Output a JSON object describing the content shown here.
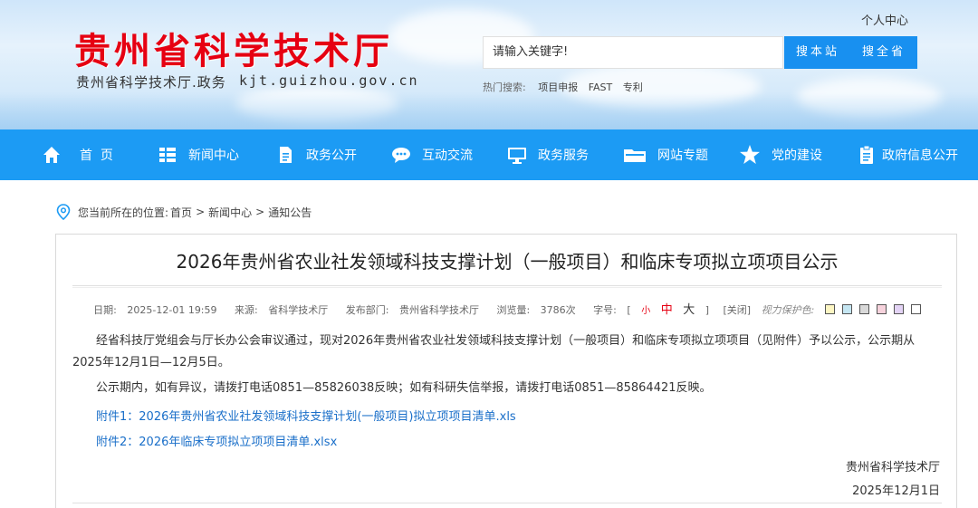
{
  "header": {
    "site_title": "贵州省科学技术厅",
    "site_subtitle": "贵州省科学技术厅.政务",
    "site_domain": "kjt.guizhou.gov.cn",
    "personal_center": "个人中心",
    "search": {
      "placeholder": "请输入关键字!",
      "btn_site": "搜本站",
      "btn_all": "搜全省"
    },
    "hot": {
      "label": "热门搜索:",
      "items": [
        "项目申报",
        "FAST",
        "专利"
      ]
    }
  },
  "nav": {
    "items": [
      {
        "label": "首  页",
        "icon": "home-icon"
      },
      {
        "label": "新闻中心",
        "icon": "grid-list-icon"
      },
      {
        "label": "政务公开",
        "icon": "document-icon"
      },
      {
        "label": "互动交流",
        "icon": "chat-bubble-icon"
      },
      {
        "label": "政务服务",
        "icon": "monitor-icon"
      },
      {
        "label": "网站专题",
        "icon": "folder-icon"
      },
      {
        "label": "党的建设",
        "icon": "star-icon"
      },
      {
        "label": "政府信息公开",
        "icon": "clipboard-icon"
      }
    ]
  },
  "breadcrumb": {
    "prefix": "您当前所在的位置:",
    "home": "首页",
    "sep": ">",
    "section": "新闻中心",
    "current": "通知公告"
  },
  "article": {
    "title": "2026年贵州省农业社发领域科技支撑计划（一般项目）和临床专项拟立项项目公示",
    "meta": {
      "date_label": "日期:",
      "date": "2025-12-01 19:59",
      "source_label": "来源:",
      "source": "省科学技术厅",
      "dept_label": "发布部门:",
      "dept": "贵州省科学技术厅",
      "views_label": "浏览量:",
      "views": "3786次",
      "font_label": "字号:",
      "bracket_open": "[",
      "small": "小",
      "mid": "中",
      "big": "大",
      "bracket_close": "]",
      "close": "[关闭]",
      "protect_label": "视力保护色:",
      "swatches": [
        "#fdf6c3",
        "#c5e6f2",
        "#d9d9d9",
        "#f6d2dc",
        "#e3d3f5",
        "#ffffff"
      ]
    },
    "p1": "经省科技厅党组会与厅长办公会审议通过，现对2026年贵州省农业社发领域科技支撑计划（一般项目）和临床专项拟立项项目（见附件）予以公示，公示期从2025年12月1日—12月5日。",
    "p2": "公示期内，如有异议，请拨打电话0851—85826038反映；如有科研失信举报，请拨打电话0851—85864421反映。",
    "attachment1": "附件1：2026年贵州省农业社发领域科技支撑计划(一般项目)拟立项项目清单.xls",
    "attachment2": "附件2：2026年临床专项拟立项项目清单.xlsx",
    "signature": "贵州省科学技术厅",
    "sign_date": "2025年12月1日"
  },
  "colors": {
    "brand_red": "#e60012",
    "nav_blue": "#1c9bf4",
    "button_blue": "#1890f0",
    "link_blue": "#1a6fc9"
  }
}
